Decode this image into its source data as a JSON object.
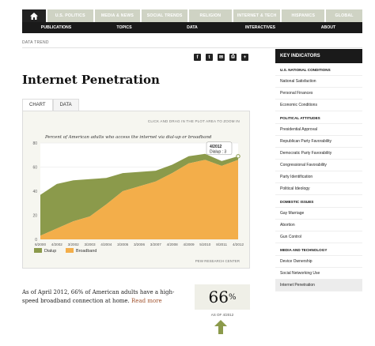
{
  "top_tabs": [
    {
      "label": "U.S. Politics"
    },
    {
      "label": "Media & News"
    },
    {
      "label": "Social Trends"
    },
    {
      "label": "Religion"
    },
    {
      "label": "Internet & Tech"
    },
    {
      "label": "Hispanics"
    },
    {
      "label": "Global"
    }
  ],
  "nav": [
    "Publications",
    "Topics",
    "Data",
    "Interactives",
    "About"
  ],
  "breadcrumb": "DATA TREND",
  "share_icons": [
    "facebook-icon",
    "twitter-icon",
    "email-icon",
    "print-icon",
    "plus-icon"
  ],
  "page_title": "Internet Penetration",
  "view_tabs": [
    "Chart",
    "Data"
  ],
  "chart_hint": "CLICK AND DRAG IN THE PLOT AREA TO ZOOM IN",
  "chart_credit": "PEW RESEARCH CENTER",
  "colors": {
    "dialup": "#8b9a4b",
    "broadband": "#f3ae4a"
  },
  "chart_data": {
    "type": "area",
    "title": "Percent of American adults who access the internet via dial-up or broadband",
    "categories": [
      "6/2000",
      "4/2002",
      "3/2002",
      "3/2003",
      "4/2004",
      "3/2005",
      "3/2006",
      "3/2007",
      "4/2008",
      "4/2009",
      "5/2010",
      "8/2011",
      "4/2012"
    ],
    "series": [
      {
        "name": "Dialup",
        "values": [
          34,
          37,
          34,
          31,
          22,
          15,
          12,
          9,
          7,
          6,
          5,
          4,
          3
        ]
      },
      {
        "name": "Broadband",
        "values": [
          3,
          9,
          15,
          19,
          29,
          40,
          44,
          48,
          55,
          63,
          66,
          61,
          66
        ]
      }
    ],
    "ylim": [
      0,
      80
    ],
    "yticks": [
      0,
      20,
      40,
      60,
      80
    ],
    "stacked": true,
    "legend_position": "bottom-left",
    "tooltip": {
      "date": "4/2012",
      "series": "Dialup",
      "value": "3"
    }
  },
  "summary": {
    "text": "As of April 2012, 66% of American adults have a high-speed broadband connection at home.",
    "link": "Read more"
  },
  "stat": {
    "value": "66",
    "unit": "%",
    "as_of": "AS OF 4/2012"
  },
  "sidebar": {
    "header": "Key Indicators",
    "sections": [
      {
        "title": "U.S. National Conditions",
        "items": [
          "National Satisfaction",
          "Personal Finances",
          "Economic Conditions"
        ]
      },
      {
        "title": "Political Attitudes",
        "items": [
          "Presidential Approval",
          "Republican Party Favorability",
          "Democratic Party Favorability",
          "Congressional Favorability",
          "Party Identification",
          "Political Ideology"
        ]
      },
      {
        "title": "Domestic Issues",
        "items": [
          "Gay Marriage",
          "Abortion",
          "Gun Control"
        ]
      },
      {
        "title": "Media and Technology",
        "items": [
          "Device Ownership",
          "Social Networking Use",
          "Internet Penetration"
        ]
      }
    ],
    "active_item": "Internet Penetration"
  }
}
